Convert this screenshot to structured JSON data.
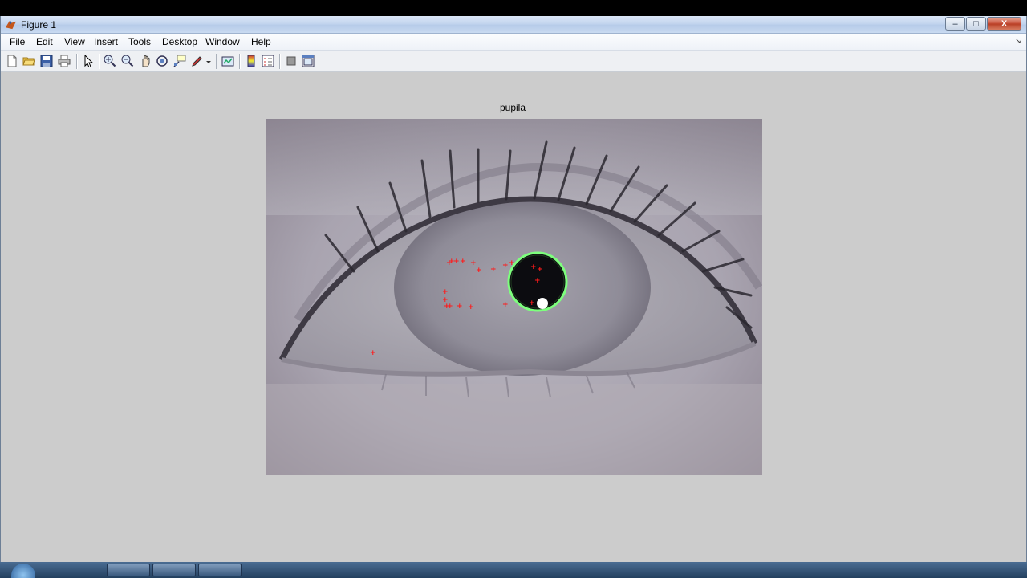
{
  "window": {
    "title": "Figure 1"
  },
  "window_controls": {
    "minimize": "–",
    "maximize": "□",
    "close": "X"
  },
  "menu": [
    "File",
    "Edit",
    "View",
    "Insert",
    "Tools",
    "Desktop",
    "Window",
    "Help"
  ],
  "dock_arrow": "↘",
  "toolbar_icons": [
    "new-figure-icon",
    "open-file-icon",
    "save-icon",
    "print-icon",
    "edit-plot-icon",
    "zoom-in-icon",
    "zoom-out-icon",
    "pan-icon",
    "rotate-3d-icon",
    "data-cursor-icon",
    "brush-icon",
    "link-plot-icon",
    "colorbar-icon",
    "legend-icon",
    "hide-plot-tools-icon",
    "show-plot-tools-icon"
  ],
  "axes": {
    "title": "pupila"
  },
  "colors": {
    "marker": "#ff1a1a",
    "circle": "#7dff7d",
    "pupil": "#0c0c10"
  }
}
